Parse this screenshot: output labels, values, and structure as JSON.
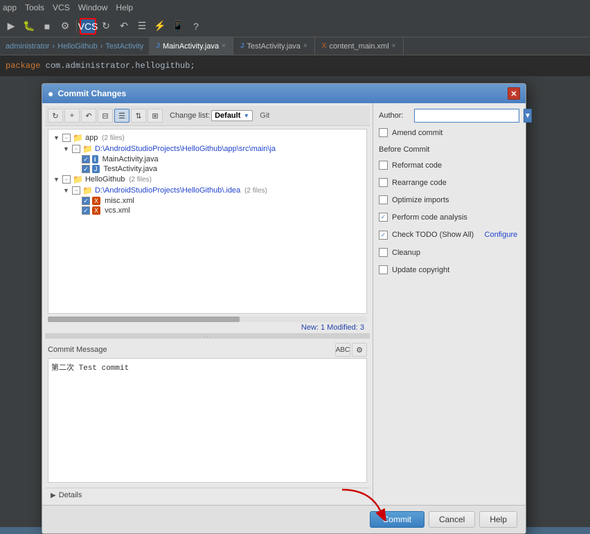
{
  "ide": {
    "menu_items": [
      "app",
      "Tools",
      "VCS",
      "Window",
      "Help"
    ],
    "breadcrumb": {
      "admin": "administrator",
      "arrow": "›",
      "repo": "HelloGithub",
      "arrow2": "›",
      "activity": "TestActivity"
    },
    "tabs": [
      {
        "label": "MainActivity.java",
        "active": true,
        "icon": "java"
      },
      {
        "label": "TestActivity.java",
        "active": false,
        "icon": "java"
      },
      {
        "label": "content_main.xml",
        "active": false,
        "icon": "xml"
      }
    ],
    "code_line": "package com.administrator.hellogithub;"
  },
  "dialog": {
    "title": "Commit Changes",
    "title_icon": "●",
    "toolbar": {
      "changelist_label": "Change list:",
      "changelist_value": "Default",
      "git_label": "Git"
    },
    "tree": {
      "items": [
        {
          "indent": 0,
          "type": "group",
          "check": "partial",
          "arrow": "▼",
          "icon": "folder",
          "label": "app",
          "sub": "(2 files)"
        },
        {
          "indent": 1,
          "type": "group",
          "check": "partial",
          "arrow": "▼",
          "icon": "folder",
          "label": "D:\\AndroidStudioProjects\\HelloGithub\\app\\src\\main\\ja",
          "sub": "",
          "blue": true
        },
        {
          "indent": 2,
          "type": "file",
          "check": "checked",
          "arrow": "",
          "icon": "java",
          "label": "MainActivity.java",
          "sub": ""
        },
        {
          "indent": 2,
          "type": "file",
          "check": "checked",
          "arrow": "",
          "icon": "java",
          "label": "TestActivity.java",
          "sub": ""
        },
        {
          "indent": 0,
          "type": "group",
          "check": "partial",
          "arrow": "▼",
          "icon": "folder",
          "label": "HelloGithub",
          "sub": "(2 files)"
        },
        {
          "indent": 1,
          "type": "group",
          "check": "partial",
          "arrow": "▼",
          "icon": "folder",
          "label": "D:\\AndroidStudioProjects\\HelloGithub\\.idea",
          "sub": "(2 files)",
          "blue": true
        },
        {
          "indent": 2,
          "type": "file",
          "check": "checked",
          "arrow": "",
          "icon": "xml",
          "label": "misc.xml",
          "sub": ""
        },
        {
          "indent": 2,
          "type": "file",
          "check": "checked",
          "arrow": "",
          "icon": "xml",
          "label": "vcs.xml",
          "sub": ""
        }
      ]
    },
    "stats": "New: 1   Modified: 3",
    "commit_message": {
      "label": "Commit Message",
      "value": "第二次 Test commit"
    },
    "details_label": "Details",
    "right": {
      "author_label": "Author:",
      "author_value": "",
      "amend_label": "Amend commit",
      "before_commit_label": "Before Commit",
      "options": [
        {
          "label": "Reformat code",
          "checked": false
        },
        {
          "label": "Rearrange code",
          "checked": false
        },
        {
          "label": "Optimize imports",
          "checked": false
        },
        {
          "label": "Perform code analysis",
          "checked": true
        },
        {
          "label": "Check TODO (Show All)",
          "checked": true,
          "link": "Configure"
        },
        {
          "label": "Cleanup",
          "checked": false
        },
        {
          "label": "Update copyright",
          "checked": false
        }
      ]
    },
    "buttons": {
      "commit": "Commit",
      "cancel": "Cancel",
      "help": "Help"
    }
  }
}
